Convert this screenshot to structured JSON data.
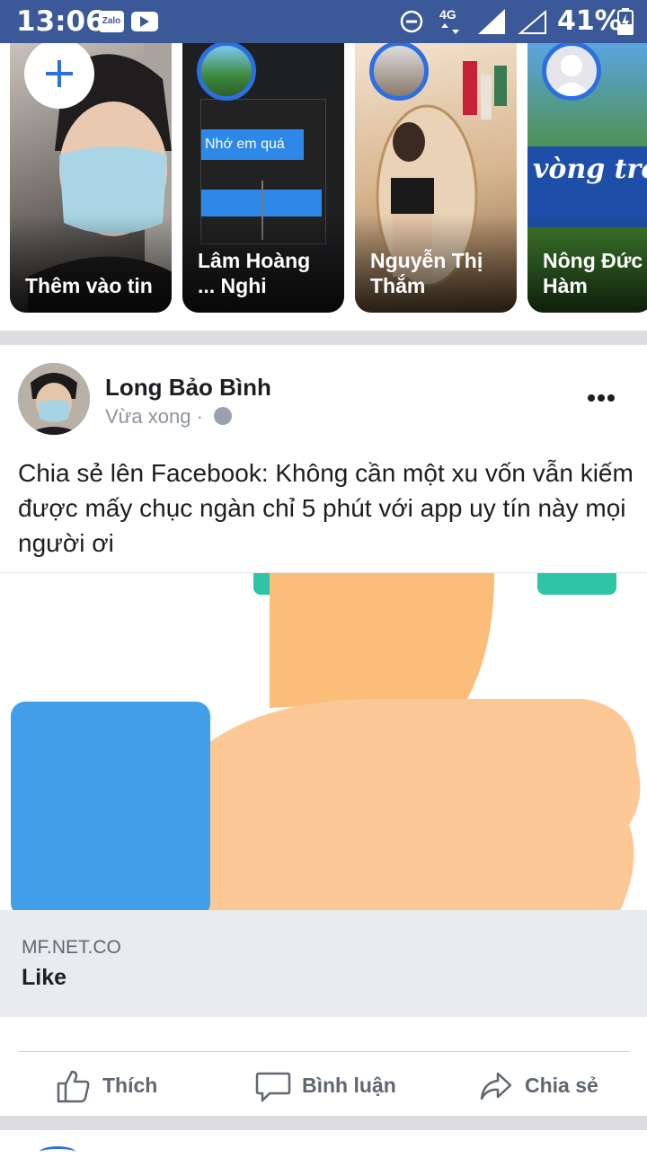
{
  "status_bar": {
    "time": "13:06",
    "notification_icons": [
      "zalo-icon",
      "youtube-icon"
    ],
    "zalo_label": "Zalo",
    "network": "4G",
    "battery_percent": "41%",
    "bg_color": "#3b5998"
  },
  "stories": [
    {
      "label": "Thêm vào tin",
      "type": "add"
    },
    {
      "label": "Lâm Hoàng ... Nghi",
      "type": "story"
    },
    {
      "label": "Nguyễn Thị Thắm",
      "type": "story"
    },
    {
      "label": "Nông Đức Hàm",
      "type": "story"
    }
  ],
  "post": {
    "author": "Long Bảo Bình",
    "time": "Vừa xong ·",
    "text": "Chia sẻ lên Facebook: Không cần một xu vốn vẫn kiếm được mấy chục ngàn chỉ 5 phút với app uy tín này mọi người ơi",
    "link": {
      "domain": "MF.NET.CO",
      "title": "Like"
    }
  },
  "actions": {
    "like_label": "Thích",
    "comment_label": "Bình luận",
    "share_label": "Chia sẻ"
  },
  "colors": {
    "accent": "#2d6fe0",
    "thumb_skin": "#fcc996",
    "thumb_dark": "#fbbd7a",
    "cuff_blue": "#42a0ea",
    "teal": "#2fc4a6"
  }
}
